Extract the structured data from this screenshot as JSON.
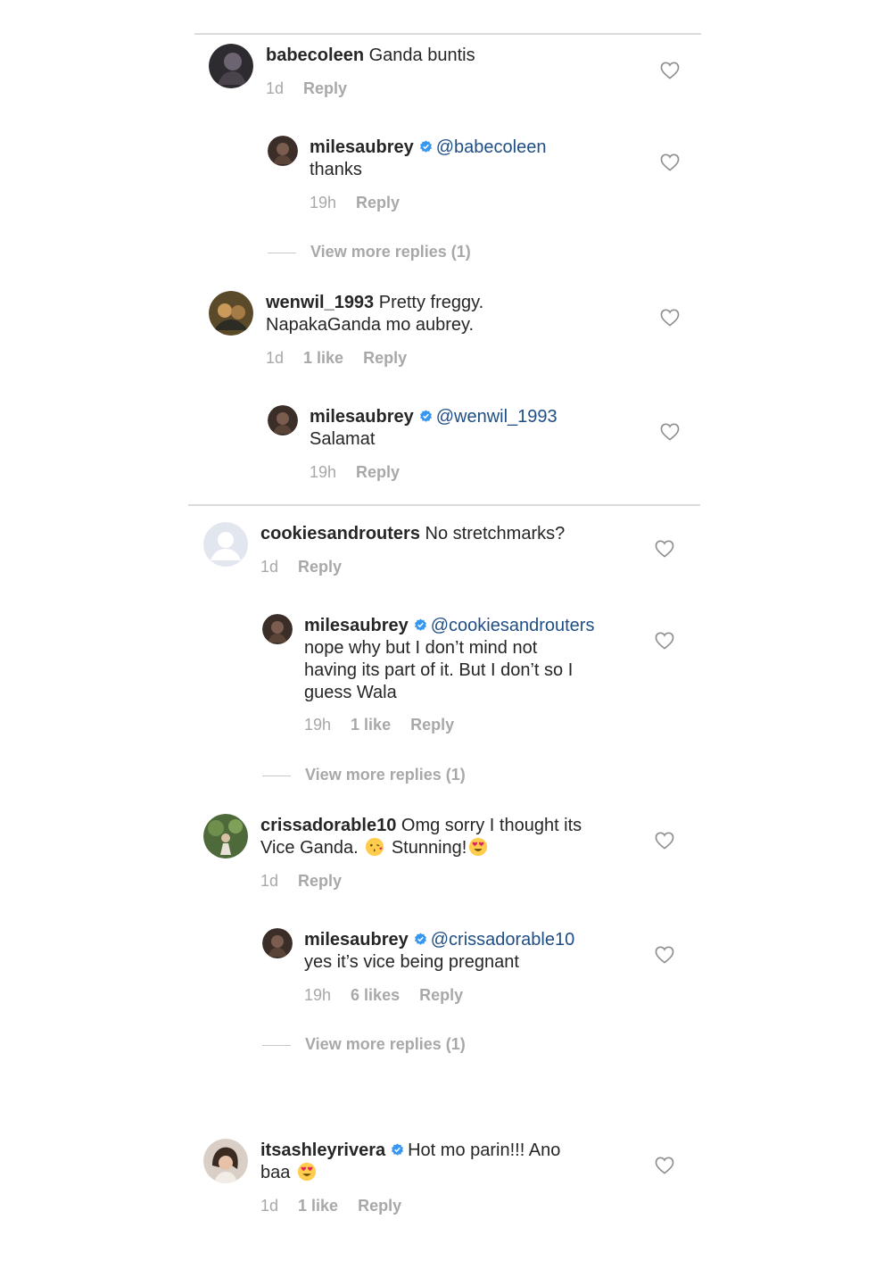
{
  "comments": [
    {
      "user": "babecoleen",
      "text": "Ganda buntis",
      "time": "1d",
      "reply": "Reply",
      "replies": [
        {
          "user": "milesaubrey",
          "mention": "@babecoleen",
          "text": "thanks",
          "time": "19h",
          "reply": "Reply"
        }
      ],
      "view_more": "View more replies (1)"
    },
    {
      "user": "wenwil_1993",
      "text_line1": "Pretty freggy.",
      "text_line2": "NapakaGanda mo aubrey.",
      "time": "1d",
      "likes": "1 like",
      "reply": "Reply",
      "replies": [
        {
          "user": "milesaubrey",
          "mention": "@wenwil_1993",
          "text": "Salamat",
          "time": "19h",
          "reply": "Reply"
        }
      ]
    },
    {
      "user": "cookiesandrouters",
      "text": "No stretchmarks?",
      "time": "1d",
      "reply": "Reply",
      "replies": [
        {
          "user": "milesaubrey",
          "mention": "@cookiesandrouters",
          "text_line1": "nope why but I don’t mind not",
          "text_line2": "having its part of it. But I don’t so I",
          "text_line3": "guess Wala",
          "time": "19h",
          "likes": "1 like",
          "reply": "Reply"
        }
      ],
      "view_more": "View more replies (1)"
    },
    {
      "user": "crissadorable10",
      "text_line1": "Omg sorry I thought its",
      "text_line2a": "Vice Ganda.",
      "text_line2b": "Stunning!",
      "time": "1d",
      "reply": "Reply",
      "replies": [
        {
          "user": "milesaubrey",
          "mention": "@crissadorable10",
          "text": "yes it’s vice being pregnant",
          "time": "19h",
          "likes": "6 likes",
          "reply": "Reply"
        }
      ],
      "view_more": "View more replies (1)"
    },
    {
      "user": "itsashleyrivera",
      "text_line1": "Hot mo parin!!! Ano",
      "text_line2": "baa",
      "time": "1d",
      "likes": "1 like",
      "reply": "Reply"
    }
  ],
  "icons": {
    "like": "heart-outline-icon",
    "verified": "verified-badge-icon",
    "emoji_kiss": "kiss-emoji",
    "emoji_heart_eyes": "heart-eyes-emoji"
  },
  "colors": {
    "mention": "#1f4e85",
    "verified": "#3897f0",
    "muted": "#a8a8a8",
    "divider": "#dbdbdb"
  }
}
